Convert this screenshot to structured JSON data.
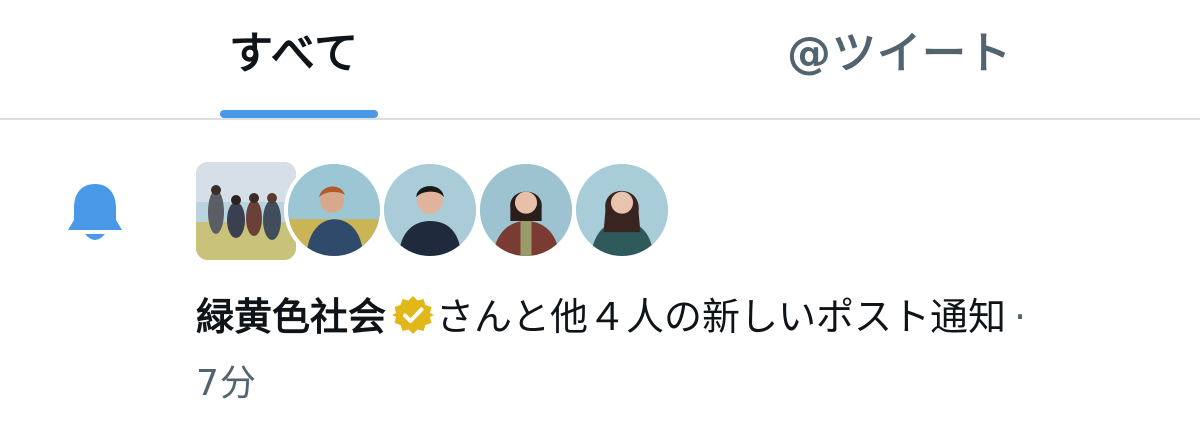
{
  "tabs": {
    "all_label": "すべて",
    "mentions_label": "@ツイート"
  },
  "notification": {
    "icon": "bell-icon",
    "sender": "緑黄色社会",
    "verified_badge": "verified-gold-icon",
    "message": "さんと他４人の新しいポスト通知",
    "separator": "·",
    "time": "7分"
  },
  "colors": {
    "accent": "#4a99e9",
    "verified_gold": "#e2b719",
    "muted_text": "#536471"
  }
}
